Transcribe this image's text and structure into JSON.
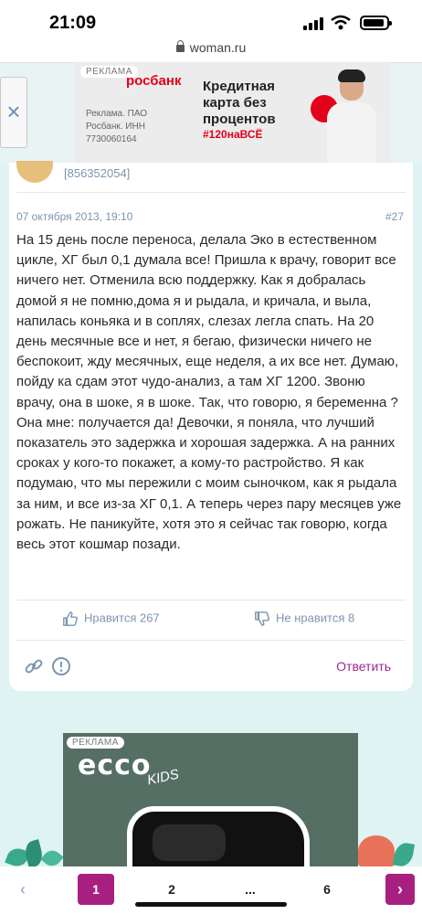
{
  "status_bar": {
    "time": "21:09"
  },
  "browser": {
    "url": "woman.ru"
  },
  "top_ad": {
    "tag": "РЕКЛАМА",
    "brand": "росбанк",
    "title": "Кредитная карта без процентов",
    "hashtag": "#120наВСЁ",
    "legal": "Реклама. ПАО Росбанк. ИНН 7730060164",
    "close_symbol": "×"
  },
  "comment": {
    "user_id": "[856352054]",
    "date": "07 октября 2013, 19:10",
    "number": "#27",
    "text": "На 15 день после переноса, делала Эко в естественном цикле, ХГ был 0,1 думала все! Пришла к врачу, говорит все ничего нет. Отменила всю поддержку. Как я добралась домой я не помню,дома я и рыдала, и кричала, и выла, напилась коньяка и в соплях, слезах легла спать. На 20 день месячные все и нет, я бегаю, физически ничего не беспокоит, жду месячных, еще неделя, а их все нет. Думаю, пойду ка сдам этот чудо-анализ, а там ХГ 1200. Звоню врачу, она в шоке, я в шоке. Так, что говорю, я беременна ? Она мне: получается да! Девочки, я поняла, что лучший показатель это задержка и хорошая задержка. А на ранних сроках у кого-то покажет, а кому-то растройство. Я как подумаю, что мы пережили с моим сыночком, как я рыдала за ним, и все из-за ХГ 0,1. А теперь через пару месяцев уже рожать. Не паникуйте, хотя это я сейчас так говорю, когда весь этот кошмар позади.",
    "like_label": "Нравится 267",
    "dislike_label": "Не нравится 8",
    "reply_label": "Ответить"
  },
  "second_ad": {
    "tag": "РЕКЛАМА",
    "brand": "ecco",
    "sub_brand": "KIDS"
  },
  "pagination": {
    "prev": "‹",
    "pages": [
      "1",
      "2",
      "...",
      "6"
    ],
    "next": "›",
    "current": "1"
  },
  "colors": {
    "accent": "#a8207f",
    "muted_text": "#7d95b0",
    "background": "#dff3f3"
  }
}
